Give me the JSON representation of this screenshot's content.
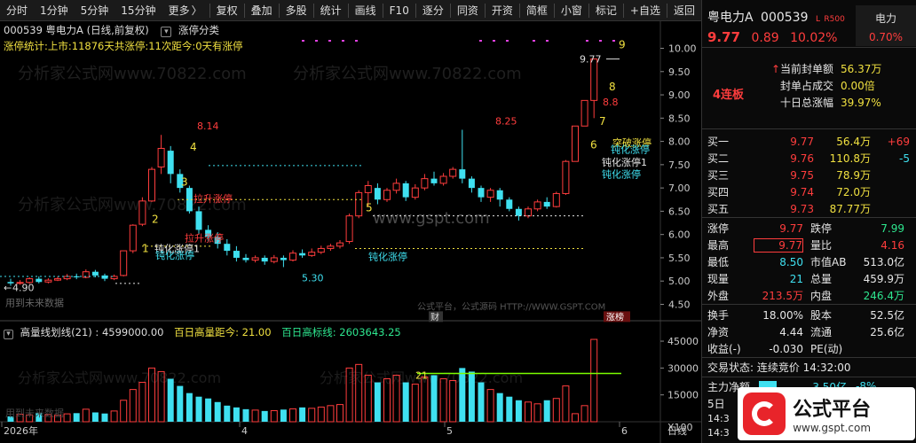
{
  "toolbar": {
    "left": [
      "分时",
      "1分钟",
      "5分钟",
      "15分钟",
      "更多"
    ],
    "left_more_arrow": "〉",
    "right": [
      "复权",
      "叠加",
      "多股",
      "统计",
      "画线",
      "F10",
      "逐分",
      "同资",
      "开资",
      "简框",
      "小窗",
      "标记",
      "+自选",
      "返回"
    ]
  },
  "chart": {
    "header": "000539 粤电力A (日线,前复权)",
    "tag": "涨停分类",
    "stat_line": "涨停统计:上市:11876天共涨停:11次距今:0天有涨停",
    "y_labels": [
      "10.00",
      "9.50",
      "9.00",
      "8.50",
      "8.00",
      "7.50",
      "7.00",
      "6.50",
      "6.00",
      "5.50",
      "5.00",
      "4.50"
    ],
    "price_labels": {
      "high1": "8.14",
      "high2": "8.25",
      "low1": "5.30",
      "last_high": "9.77",
      "pre": "8.8",
      "start": "4.90"
    },
    "annotations": {
      "a1": "钝化涨停1",
      "a2": "拉升涨停",
      "a3": "拉升涨停",
      "a4": "钝化涨停",
      "a5": "突破涨停",
      "a6": "钝化涨停",
      "a7": "钝化涨停1",
      "a8": "钝化涨停"
    },
    "numbers": [
      "1",
      "2",
      "3",
      "4",
      "5",
      "6",
      "7",
      "8",
      "9"
    ],
    "future": "用到未来数据",
    "watermark1": "分析家公式网www.70822.com",
    "watermark2": "www.gspt.com",
    "source": "公式平台，公式源码 HTTP://WWW.GSPT.COM",
    "tag_cai": "财",
    "tag_zhangbang": "涨榜",
    "start_arrow": "←"
  },
  "vol": {
    "title": "高量线划线(21) : 4599000.00",
    "f1_label": "百日高量距今: 21.00",
    "f2_label": "百日高标线: 2603643.25",
    "y_labels": [
      "45000",
      "30000",
      "15000",
      "X100"
    ],
    "marker": "21",
    "footer_faint": "用到未来数据"
  },
  "xaxis": {
    "labels": [
      "2026年",
      "4",
      "5",
      "6"
    ],
    "period": "日线"
  },
  "panel": {
    "name": "粤电力A",
    "code": "000539",
    "badge_l": "L",
    "badge_r": "R500",
    "sector": "电力",
    "sector_pct": "0.70%",
    "price": "9.77",
    "change": "0.89",
    "pct": "10.02%",
    "seal_rows": [
      {
        "label": "当前封单额",
        "value": "56.37万"
      },
      {
        "label": "封单占成交",
        "value": "0.00倍"
      },
      {
        "label": "十日总涨幅",
        "value": "39.97%"
      }
    ],
    "streak": "4连板",
    "buys": [
      {
        "name": "买一",
        "price": "9.77",
        "vol": "56.4万",
        "chg": "+69"
      },
      {
        "name": "买二",
        "price": "9.76",
        "vol": "110.8万",
        "chg": "-5"
      },
      {
        "name": "买三",
        "price": "9.75",
        "vol": "78.9万",
        "chg": ""
      },
      {
        "name": "买四",
        "price": "9.74",
        "vol": "72.0万",
        "chg": ""
      },
      {
        "name": "买五",
        "price": "9.73",
        "vol": "87.77万",
        "chg": ""
      }
    ],
    "stats": [
      {
        "l1": "涨停",
        "v1": "9.77",
        "l2": "跌停",
        "v2": "7.99"
      },
      {
        "l1": "最高",
        "v1": "9.77",
        "l2": "量比",
        "v2": "4.16"
      },
      {
        "l1": "最低",
        "v1": "8.50",
        "l2": "市值AB",
        "v2": "513.0亿"
      },
      {
        "l1": "现量",
        "v1": "21",
        "l2": "总量",
        "v2": "459.9万"
      },
      {
        "l1": "外盘",
        "v1": "213.5万",
        "l2": "内盘",
        "v2": "246.4万"
      }
    ],
    "stats2": [
      {
        "l1": "换手",
        "v1": "18.00%",
        "l2": "股本",
        "v2": "52.5亿"
      },
      {
        "l1": "净资",
        "v1": "4.44",
        "l2": "流通",
        "v2": "25.6亿"
      },
      {
        "l1": "收益(-)",
        "v1": "-0.030",
        "l2": "PE(动)",
        "v2": ""
      }
    ],
    "trade_state": "交易状态: 连续竞价 14:32:00",
    "main_flow_label": "主力净额",
    "main_flow_v1": "-3.50亿",
    "main_flow_v2": "-8%",
    "day5": "5日",
    "time1": "14:3",
    "time2": "14:3",
    "logo_text": "公式平台",
    "logo_url": "www.gspt.com"
  }
}
